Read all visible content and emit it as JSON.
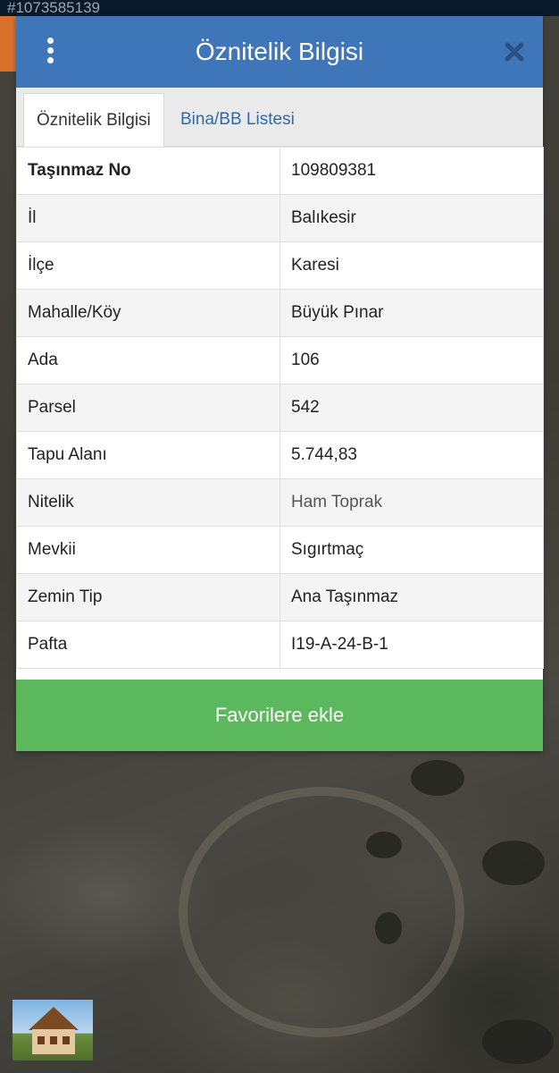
{
  "watermark_text": "#1073585139",
  "modal": {
    "title": "Öznitelik Bilgisi",
    "menu_icon": "kebab-menu-icon",
    "close_icon": "close-icon"
  },
  "tabs": [
    {
      "label": "Öznitelik Bilgisi",
      "active": true
    },
    {
      "label": "Bina/BB Listesi",
      "active": false
    }
  ],
  "attributes": [
    {
      "key": "Taşınmaz No",
      "value": "109809381"
    },
    {
      "key": "İl",
      "value": "Balıkesir"
    },
    {
      "key": "İlçe",
      "value": "Karesi"
    },
    {
      "key": "Mahalle/Köy",
      "value": "Büyük Pınar"
    },
    {
      "key": "Ada",
      "value": "106"
    },
    {
      "key": "Parsel",
      "value": "542"
    },
    {
      "key": "Tapu Alanı",
      "value": "5.744,83"
    },
    {
      "key": "Nitelik",
      "value": "Ham Toprak"
    },
    {
      "key": "Mevkii",
      "value": "Sıgırtmaç"
    },
    {
      "key": "Zemin Tip",
      "value": "Ana Taşınmaz"
    },
    {
      "key": "Pafta",
      "value": "I19-A-24-B-1"
    }
  ],
  "favorite_button": "Favorilere ekle",
  "colors": {
    "header": "#3f76b9",
    "tab_inactive_text": "#2f6aa8",
    "favorite_button": "#5cb85c"
  }
}
